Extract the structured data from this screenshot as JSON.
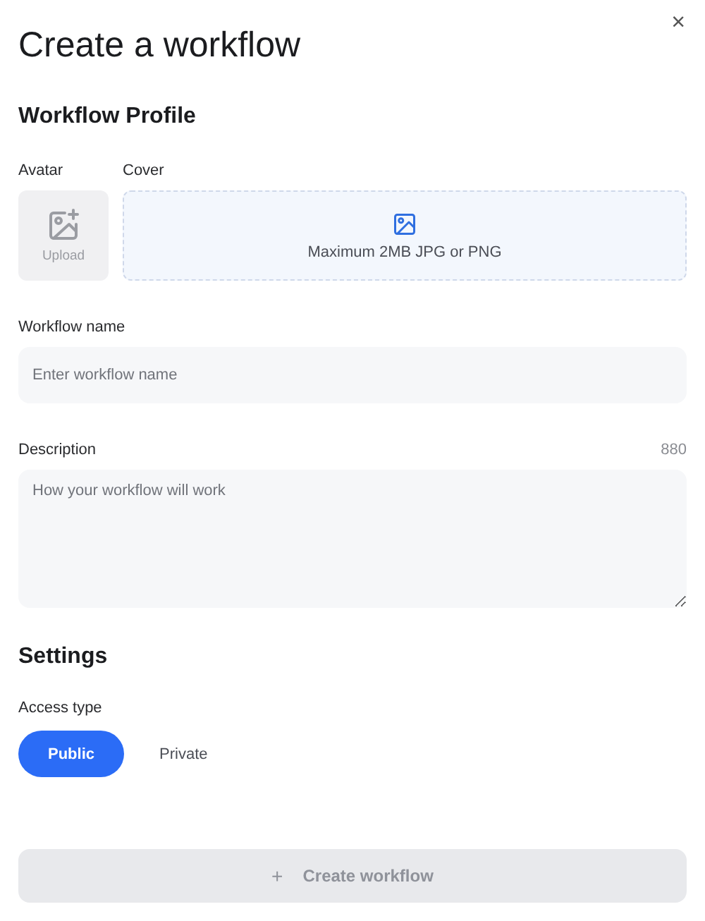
{
  "close": "×",
  "title": "Create a workflow",
  "profile": {
    "heading": "Workflow Profile",
    "avatar": {
      "label": "Avatar",
      "button": "Upload"
    },
    "cover": {
      "label": "Cover",
      "hint": "Maximum 2MB JPG or PNG"
    },
    "name": {
      "label": "Workflow name",
      "placeholder": "Enter workflow name"
    },
    "description": {
      "label": "Description",
      "counter": "880",
      "placeholder": "How your workflow will work"
    }
  },
  "settings": {
    "heading": "Settings",
    "access_label": "Access type",
    "options": [
      {
        "label": "Public",
        "selected": true
      },
      {
        "label": "Private",
        "selected": false
      }
    ]
  },
  "submit": {
    "icon": "+",
    "label": "Create workflow",
    "disabled": true
  }
}
